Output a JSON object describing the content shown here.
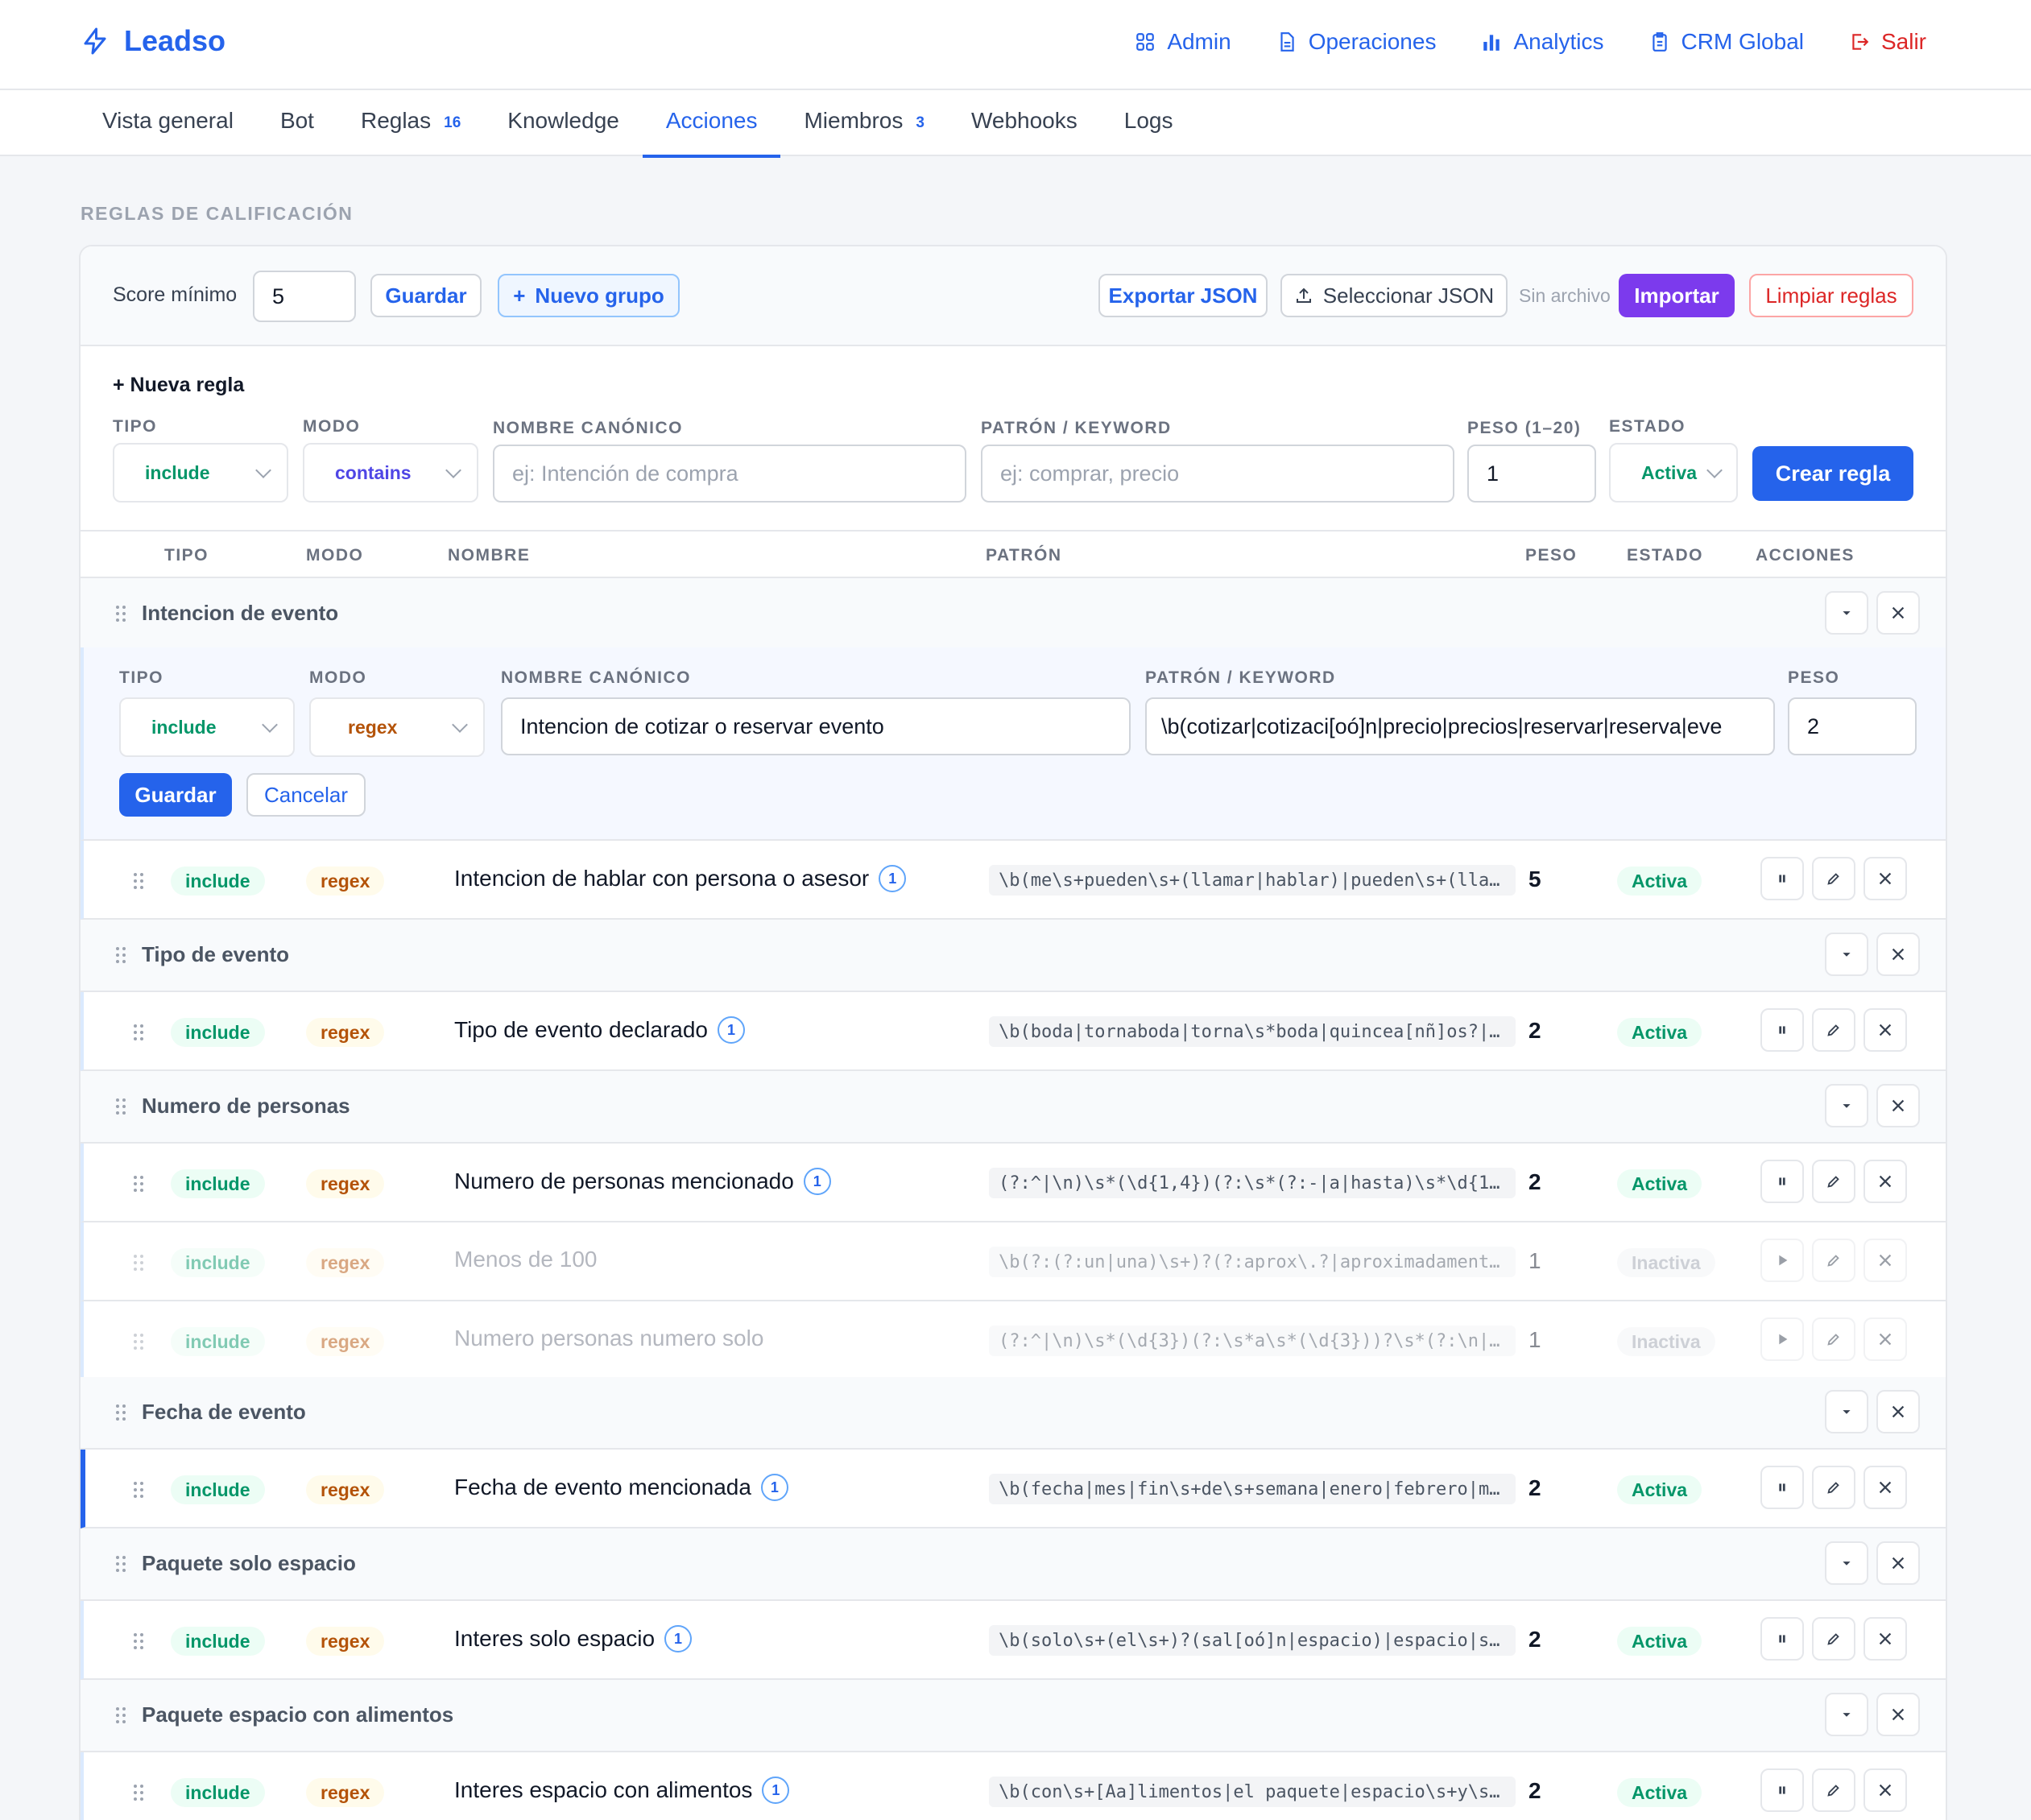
{
  "app": {
    "brand": "Leadso",
    "nav": [
      {
        "label": "Admin",
        "icon": "grid-icon"
      },
      {
        "label": "Operaciones",
        "icon": "document-icon"
      },
      {
        "label": "Analytics",
        "icon": "bar-chart-icon"
      },
      {
        "label": "CRM Global",
        "icon": "clipboard-icon"
      },
      {
        "label": "Salir",
        "icon": "logout-icon"
      }
    ]
  },
  "tabs": [
    {
      "label": "Vista general",
      "badge": ""
    },
    {
      "label": "Bot",
      "badge": ""
    },
    {
      "label": "Reglas",
      "badge": "16"
    },
    {
      "label": "Knowledge",
      "badge": ""
    },
    {
      "label": "Acciones",
      "badge": "",
      "active": true
    },
    {
      "label": "Miembros",
      "badge": "3"
    },
    {
      "label": "Webhooks",
      "badge": ""
    },
    {
      "label": "Logs",
      "badge": ""
    }
  ],
  "section_title": "REGLAS DE CALIFICACIÓN",
  "toolbar": {
    "score_label": "Score mínimo",
    "score_value": "5",
    "save": "Guardar",
    "new_group": "Nuevo grupo",
    "export": "Exportar JSON",
    "select": "Seleccionar JSON",
    "no_file": "Sin archivo",
    "import": "Importar",
    "clear": "Limpiar reglas"
  },
  "new_rule": {
    "title": "+ Nueva regla",
    "labels": {
      "type": "TIPO",
      "mode": "MODO",
      "name": "NOMBRE CANÓNICO",
      "pattern": "PATRÓN / KEYWORD",
      "weight": "PESO (1–20)",
      "state": "ESTADO"
    },
    "type": "include",
    "mode": "contains",
    "name_placeholder": "ej: Intención de compra",
    "pattern_placeholder": "ej: comprar, precio",
    "weight": "1",
    "state": "Activa",
    "create": "Crear regla"
  },
  "columns": {
    "type": "TIPO",
    "mode": "MODO",
    "name": "NOMBRE",
    "pattern": "PATRÓN",
    "weight": "PESO",
    "state": "ESTADO",
    "actions": "ACCIONES"
  },
  "edit": {
    "labels": {
      "type": "TIPO",
      "mode": "MODO",
      "name": "NOMBRE CANÓNICO",
      "pattern": "PATRÓN / KEYWORD",
      "weight": "PESO"
    },
    "type": "include",
    "mode": "regex",
    "name": "Intencion de cotizar o reservar evento",
    "pattern": "\\b(cotizar|cotizaci[oó]n|precio|precios|reservar|reserva|eve",
    "weight": "2",
    "save": "Guardar",
    "cancel": "Cancelar"
  },
  "groups": [
    {
      "name": "Intencion de evento"
    },
    {
      "name": "Tipo de evento"
    },
    {
      "name": "Numero de personas"
    },
    {
      "name": "Fecha de evento"
    },
    {
      "name": "Paquete solo espacio"
    },
    {
      "name": "Paquete espacio con alimentos"
    }
  ],
  "rules": [
    {
      "type": "include",
      "mode": "regex",
      "name": "Intencion de hablar con persona o asesor",
      "count": "1",
      "pattern": "\\b(me\\s+pueden\\s+(llamar|hablar)|pueden\\s+(lla…",
      "weight": "5",
      "state": "Activa"
    },
    {
      "type": "include",
      "mode": "regex",
      "name": "Tipo de evento declarado",
      "count": "1",
      "pattern": "\\b(boda|tornaboda|torna\\s*boda|quincea[nñ]os?|…",
      "weight": "2",
      "state": "Activa"
    },
    {
      "type": "include",
      "mode": "regex",
      "name": "Numero de personas mencionado",
      "count": "1",
      "pattern": "(?:^|\\n)\\s*(\\d{1,4})(?:\\s*(?:-|a|hasta)\\s*\\d{1…",
      "weight": "2",
      "state": "Activa"
    },
    {
      "type": "include",
      "mode": "regex",
      "name": "Menos de 100",
      "count": "",
      "pattern": "\\b(?:(?:un|una)\\s+)?(?:aprox\\.?|aproximadament…",
      "weight": "1",
      "state": "Inactiva"
    },
    {
      "type": "include",
      "mode": "regex",
      "name": "Numero personas numero solo",
      "count": "",
      "pattern": "(?:^|\\n)\\s*(\\d{3})(?:\\s*a\\s*(\\d{3}))?\\s*(?:\\n|…",
      "weight": "1",
      "state": "Inactiva"
    },
    {
      "type": "include",
      "mode": "regex",
      "name": "Fecha de evento mencionada",
      "count": "1",
      "pattern": "\\b(fecha|mes|fin\\s+de\\s+semana|enero|febrero|m…",
      "weight": "2",
      "state": "Activa"
    },
    {
      "type": "include",
      "mode": "regex",
      "name": "Interes solo espacio",
      "count": "1",
      "pattern": "\\b(solo\\s+(el\\s+)?(sal[oó]n|espacio)|espacio|s…",
      "weight": "2",
      "state": "Activa"
    },
    {
      "type": "include",
      "mode": "regex",
      "name": "Interes espacio con alimentos",
      "count": "1",
      "pattern": "\\b(con\\s+[Aa]limentos|el paquete|espacio\\s+y\\s…",
      "weight": "2",
      "state": "Activa"
    }
  ],
  "colors": {
    "accent": "#2563eb",
    "purple": "#7c3aed",
    "danger": "#dc2626",
    "success": "#059669",
    "regex": "#b45309"
  }
}
